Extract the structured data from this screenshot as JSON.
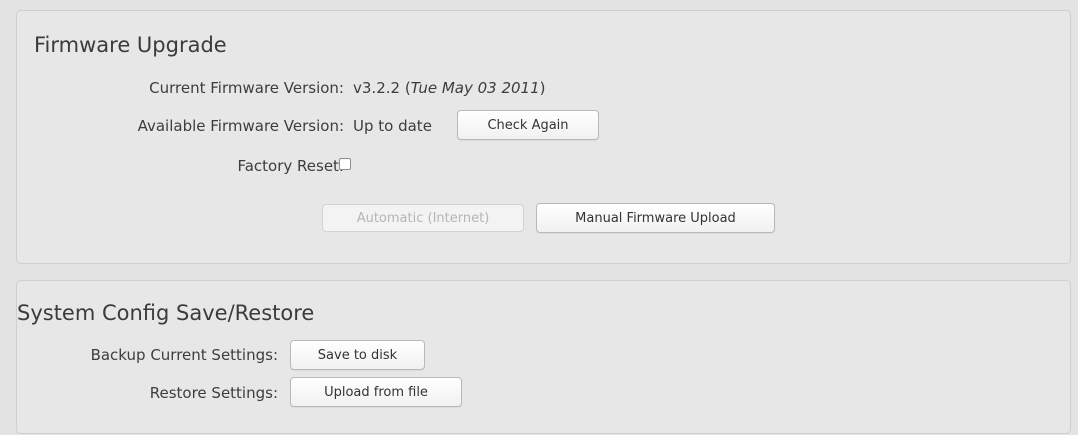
{
  "firmware": {
    "title": "Firmware Upgrade",
    "current_label": "Current Firmware Version:",
    "current_version": "v3.2.2",
    "current_date": "Tue May 03 2011",
    "available_label": "Available Firmware Version:",
    "available_value": "Up to date",
    "check_again_label": "Check Again",
    "factory_reset_label": "Factory Reset:",
    "factory_reset_checked": false,
    "automatic_label": "Automatic (Internet)",
    "manual_label": "Manual Firmware Upload"
  },
  "config": {
    "title": "System Config Save/Restore",
    "backup_label": "Backup Current Settings:",
    "save_label": "Save to disk",
    "restore_label": "Restore Settings:",
    "upload_label": "Upload from file"
  },
  "colors": {
    "panel_bg": "#e7e7e7",
    "page_bg": "#e3e3e3",
    "disabled_text": "#b5b5b5"
  }
}
